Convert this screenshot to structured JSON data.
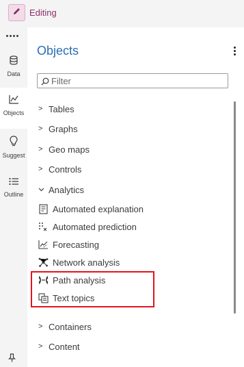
{
  "topbar": {
    "mode_label": "Editing",
    "edit_icon": "pencil-icon"
  },
  "rail": {
    "more_icon": "more-horizontal-icon",
    "items": [
      {
        "label": "Data",
        "icon": "database-icon"
      },
      {
        "label": "Objects",
        "icon": "line-chart-icon",
        "active": true
      },
      {
        "label": "Suggest",
        "icon": "lightbulb-icon"
      },
      {
        "label": "Outline",
        "icon": "list-icon"
      }
    ],
    "pin_icon": "pin-icon"
  },
  "panel": {
    "title": "Objects",
    "menu_icon": "kebab-menu-icon",
    "filter": {
      "placeholder": "Filter",
      "value": ""
    }
  },
  "categories": [
    {
      "label": "Tables",
      "expanded": false
    },
    {
      "label": "Graphs",
      "expanded": false
    },
    {
      "label": "Geo maps",
      "expanded": false
    },
    {
      "label": "Controls",
      "expanded": false
    },
    {
      "label": "Analytics",
      "expanded": true
    }
  ],
  "analytics_items": [
    {
      "label": "Automated explanation",
      "icon": "automated-explanation-icon"
    },
    {
      "label": "Automated prediction",
      "icon": "automated-prediction-icon"
    },
    {
      "label": "Forecasting",
      "icon": "forecasting-icon"
    },
    {
      "label": "Network analysis",
      "icon": "network-analysis-icon"
    },
    {
      "label": "Path analysis",
      "icon": "path-analysis-icon"
    },
    {
      "label": "Text topics",
      "icon": "text-topics-icon"
    }
  ],
  "trailing_categories": [
    {
      "label": "Containers",
      "expanded": false
    },
    {
      "label": "Content",
      "expanded": false
    }
  ],
  "colors": {
    "accent_title": "#2a6fb3",
    "editing_text": "#8c2d66",
    "highlight_box": "#e0141c"
  }
}
